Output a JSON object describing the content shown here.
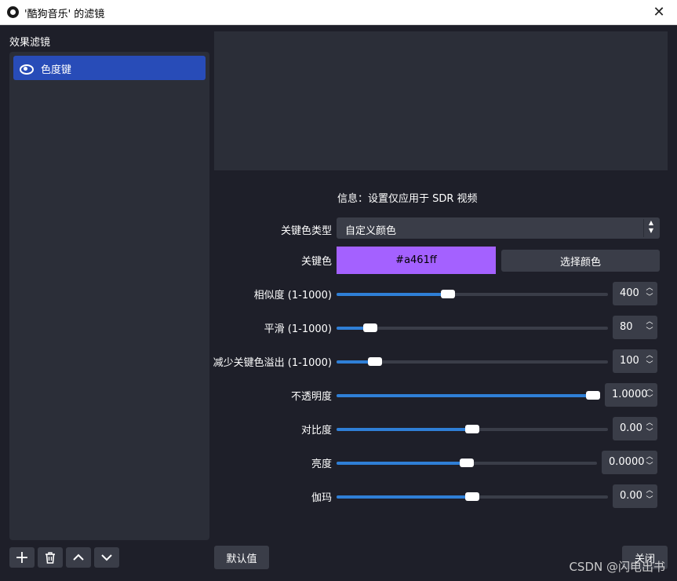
{
  "window": {
    "title": "'酷狗音乐' 的滤镜",
    "close_glyph": "✕"
  },
  "left": {
    "heading": "效果滤镜",
    "filters": [
      {
        "label": "色度键",
        "visible": true
      }
    ],
    "buttons": {
      "add": "+",
      "up": "⌃",
      "down": "⌄"
    }
  },
  "info": "信息：设置仅应用于 SDR 视频",
  "settings": {
    "key_color_type": {
      "label": "关键色类型",
      "value": "自定义颜色"
    },
    "key_color": {
      "label": "关键色",
      "value": "#a461ff",
      "pick_button": "选择颜色"
    },
    "sliders": [
      {
        "label": "相似度 (1-1000)",
        "value": "400",
        "fraction": 0.405
      },
      {
        "label": "平滑 (1-1000)",
        "value": "80",
        "fraction": 0.105
      },
      {
        "label": "减少关键色溢出 (1-1000)",
        "value": "100",
        "fraction": 0.122
      },
      {
        "label": "不透明度",
        "value": "1.0000",
        "fraction": 1.0
      },
      {
        "label": "对比度",
        "value": "0.00",
        "fraction": 0.5
      },
      {
        "label": "亮度",
        "value": "0.0000",
        "fraction": 0.5
      },
      {
        "label": "伽玛",
        "value": "0.00",
        "fraction": 0.5
      }
    ]
  },
  "footer": {
    "defaults": "默认值",
    "close": "关闭"
  },
  "watermark": "CSDN @闪电出书",
  "colors": {
    "accent": "#2f7fd6",
    "selection": "#284cb8",
    "swatch": "#a461ff"
  }
}
